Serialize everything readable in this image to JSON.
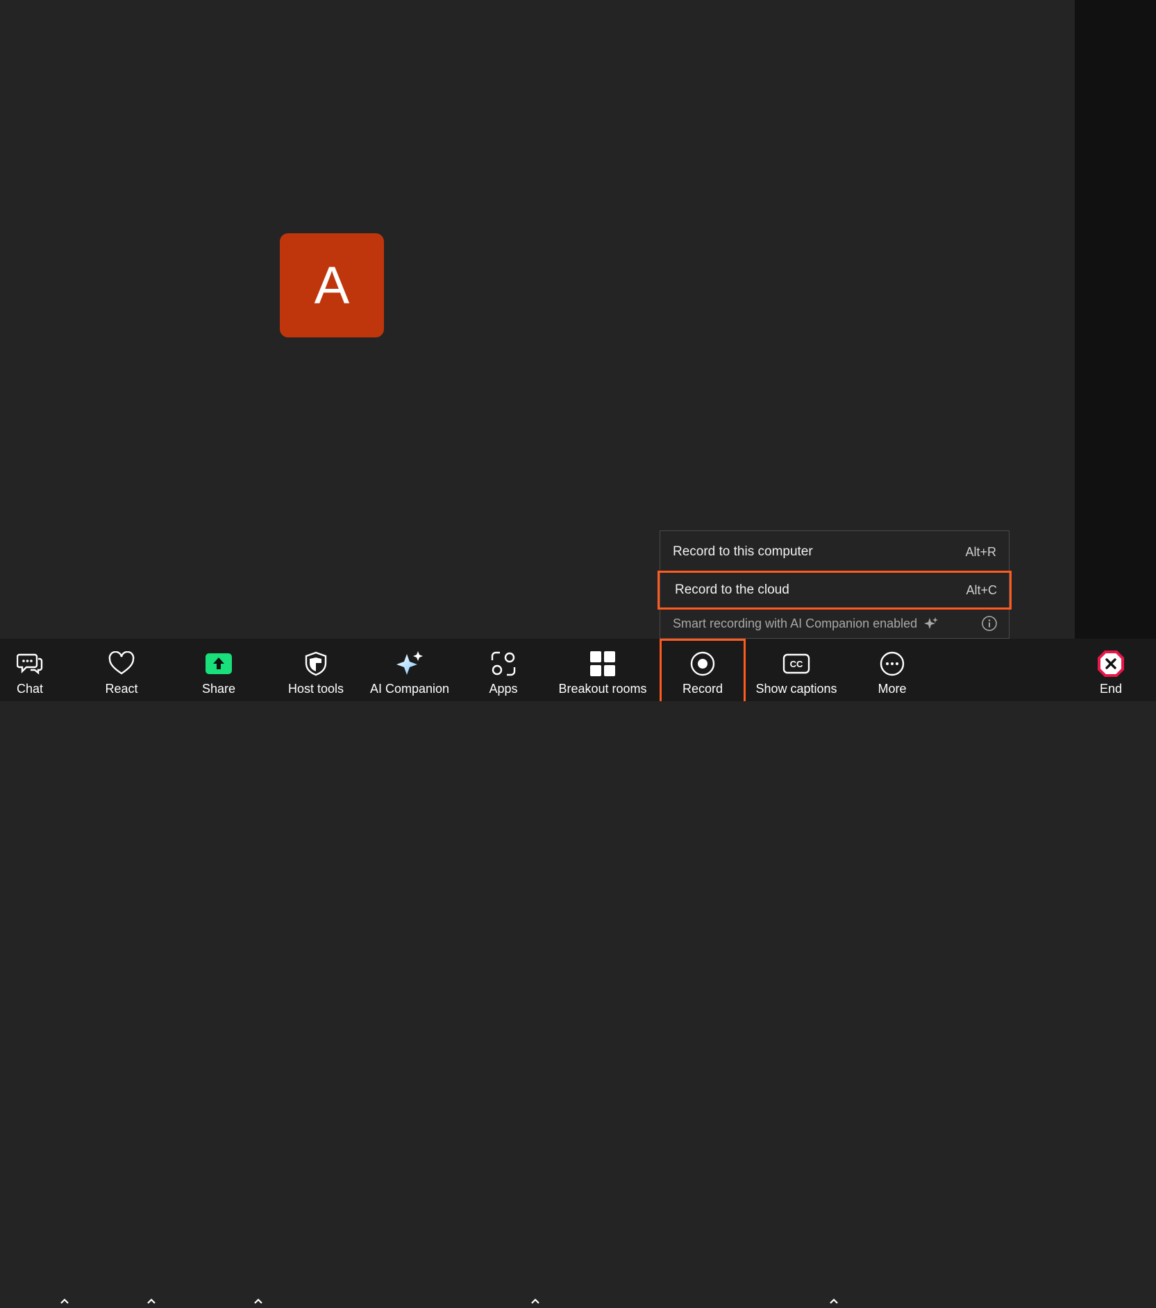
{
  "participant": {
    "initial": "A",
    "color": "#c0360c"
  },
  "record_menu": {
    "items": [
      {
        "label": "Record to this computer",
        "shortcut": "Alt+R"
      },
      {
        "label": "Record to the cloud",
        "shortcut": "Alt+C"
      }
    ],
    "smart_recording": "Smart recording with AI Companion enabled"
  },
  "toolbar": {
    "chat": "Chat",
    "react": "React",
    "share": "Share",
    "host_tools": "Host tools",
    "ai_companion": "AI Companion",
    "apps": "Apps",
    "breakout_rooms": "Breakout rooms",
    "record": "Record",
    "show_captions": "Show captions",
    "more": "More",
    "end": "End"
  },
  "colors": {
    "highlight": "#ff5a1f",
    "share_green": "#19e07a",
    "end_red": "#e8174a"
  }
}
